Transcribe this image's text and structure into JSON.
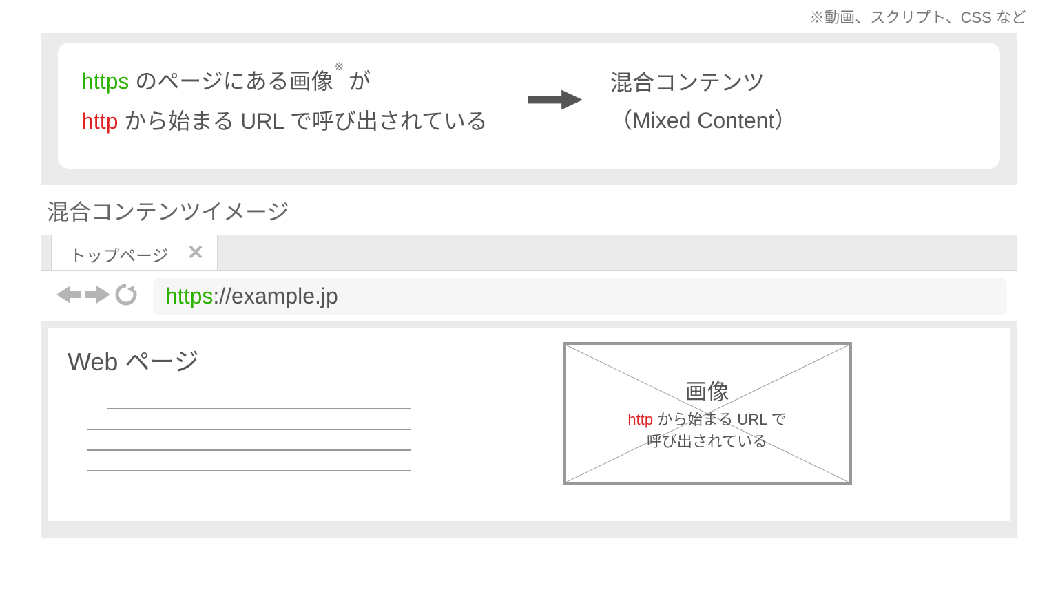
{
  "footnote_top": "※動画、スクリプト、CSS など",
  "card": {
    "https_word": "https",
    "row1_rest": " のページにある画像",
    "row1_sup": "※",
    "row1_tail": " が",
    "http_word": "http",
    "row2_rest": " から始まる URL で呼び出されている",
    "right_line1": "混合コンテンツ",
    "right_line2": "（Mixed Content）"
  },
  "image_caption": "混合コンテンツイメージ",
  "browser": {
    "tab_label": "トップページ",
    "url_https": "https",
    "url_rest": "://example.jp"
  },
  "viewport": {
    "heading": "Web ページ",
    "image_big": "画像",
    "image_http": "http",
    "image_rest": " から始まる URL で",
    "image_line2": "呼び出されている"
  }
}
